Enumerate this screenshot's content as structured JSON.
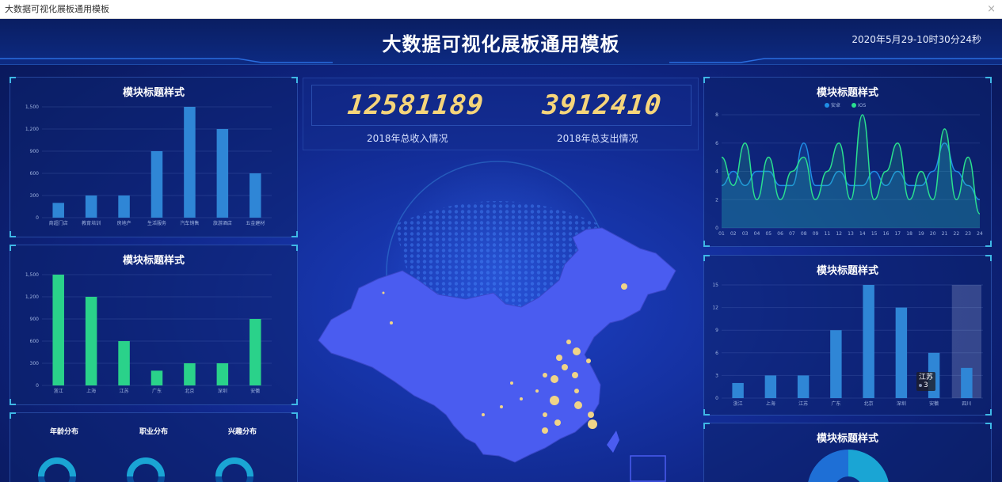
{
  "window": {
    "title": "大数据可视化展板通用模板",
    "close": "×"
  },
  "header": {
    "title": "大数据可视化展板通用模板",
    "time": "2020年5月29-10时30分24秒"
  },
  "kpi": [
    {
      "value": "12581189",
      "label": "2018年总收入情况"
    },
    {
      "value": "3912410",
      "label": "2018年总支出情况"
    }
  ],
  "panels": {
    "left_top": {
      "title": "模块标题样式"
    },
    "left_mid": {
      "title": "模块标题样式"
    },
    "right_top": {
      "title": "模块标题样式"
    },
    "right_mid": {
      "title": "模块标题样式"
    },
    "right_bottom": {
      "title": "模块标题样式"
    }
  },
  "donuts": [
    {
      "label": "年龄分布"
    },
    {
      "label": "职业分布"
    },
    {
      "label": "兴趣分布"
    }
  ],
  "tooltip": {
    "name": "江苏",
    "value": "3"
  },
  "colors": {
    "blue_bar": "#2f86d6",
    "green_bar": "#2ad28a",
    "gold": "#f6d57a",
    "map_fill": "#4a5cf0"
  },
  "chart_data": [
    {
      "id": "left_top",
      "type": "bar",
      "categories": [
        "商超门店",
        "教育培训",
        "房地产",
        "生活服务",
        "汽车销售",
        "旅游酒店",
        "五金建材"
      ],
      "values": [
        200,
        300,
        300,
        900,
        1500,
        1200,
        600
      ],
      "ylim": [
        0,
        1500
      ],
      "yticks": [
        "0",
        "300",
        "600",
        "900",
        "1,200",
        "1,500"
      ],
      "color": "#2f86d6"
    },
    {
      "id": "left_mid",
      "type": "bar",
      "categories": [
        "浙江",
        "上海",
        "江苏",
        "广东",
        "北京",
        "深圳",
        "安徽"
      ],
      "values": [
        1500,
        1200,
        600,
        200,
        300,
        300,
        900
      ],
      "ylim": [
        0,
        1500
      ],
      "yticks": [
        "0",
        "300",
        "600",
        "900",
        "1,200",
        "1,500"
      ],
      "color": "#2ad28a"
    },
    {
      "id": "right_top",
      "type": "area",
      "x": [
        "01",
        "02",
        "03",
        "04",
        "05",
        "06",
        "07",
        "08",
        "09",
        "11",
        "12",
        "13",
        "14",
        "15",
        "16",
        "17",
        "18",
        "19",
        "20",
        "21",
        "22",
        "23",
        "24"
      ],
      "series": [
        {
          "name": "安卓",
          "color": "#1f8de6",
          "values": [
            3,
            4,
            3,
            4,
            4,
            3,
            3,
            6,
            3,
            3,
            4,
            3,
            3,
            4,
            3,
            4,
            3,
            3,
            4,
            6,
            4,
            3,
            2
          ]
        },
        {
          "name": "IOS",
          "color": "#2ae08f",
          "values": [
            5,
            3,
            6,
            2,
            5,
            2,
            4,
            5,
            2,
            4,
            6,
            2,
            8,
            2,
            4,
            6,
            2,
            4,
            2,
            7,
            2,
            5,
            1
          ]
        }
      ],
      "ylim": [
        0,
        8
      ],
      "yticks": [
        "0",
        "2",
        "4",
        "6",
        "8"
      ]
    },
    {
      "id": "right_mid",
      "type": "bar",
      "categories": [
        "浙江",
        "上海",
        "江苏",
        "广东",
        "北京",
        "深圳",
        "安徽",
        "四川"
      ],
      "values": [
        2,
        3,
        3,
        9,
        15,
        12,
        6,
        4
      ],
      "ylim": [
        0,
        15
      ],
      "yticks": [
        "0",
        "3",
        "6",
        "9",
        "12",
        "15"
      ],
      "color": "#2f86d6"
    }
  ]
}
